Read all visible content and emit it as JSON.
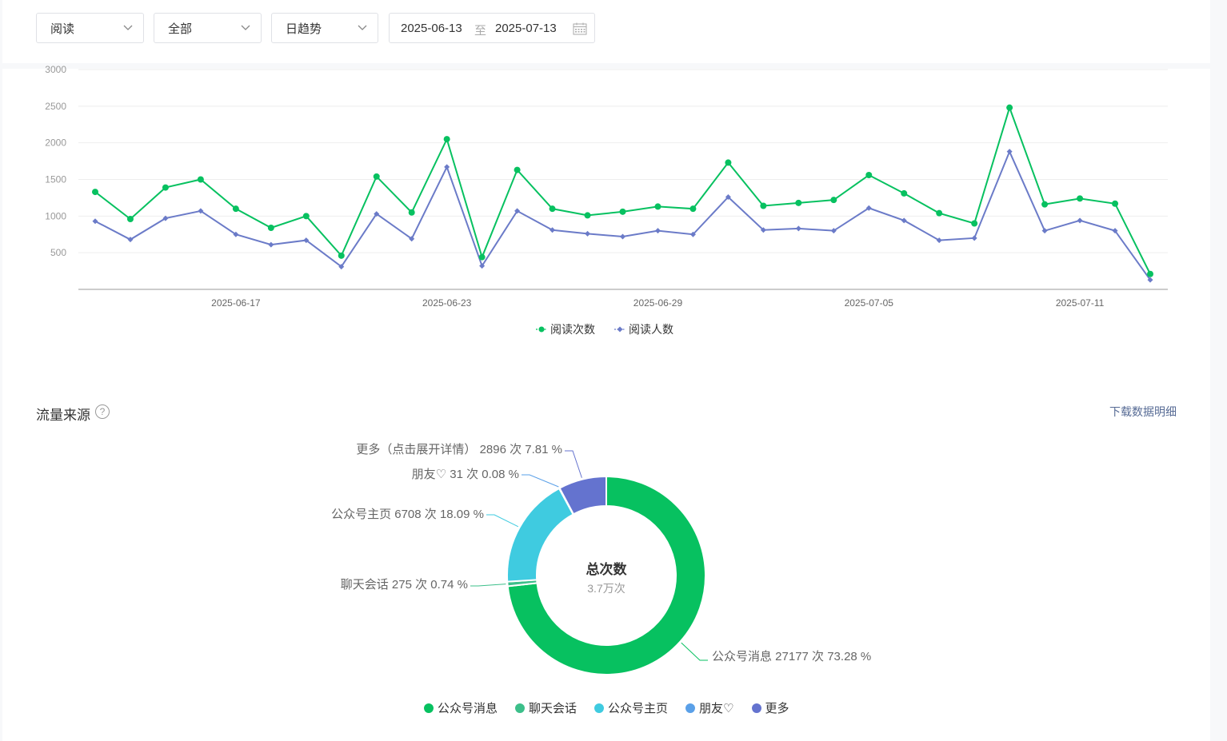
{
  "filters": {
    "metric": "阅读",
    "scope": "全部",
    "trend": "日趋势",
    "date_start": "2025-06-13",
    "date_sep": "至",
    "date_end": "2025-07-13"
  },
  "colors": {
    "green": "#07c160",
    "blue": "#6b7bc8",
    "teal": "#3cbf8a",
    "cyan": "#3fcbe0",
    "light_blue": "#5aa0e8",
    "indigo": "#6473cf"
  },
  "chart_data": [
    {
      "type": "line",
      "x": [
        "2025-06-13",
        "2025-06-14",
        "2025-06-15",
        "2025-06-16",
        "2025-06-17",
        "2025-06-18",
        "2025-06-19",
        "2025-06-20",
        "2025-06-21",
        "2025-06-22",
        "2025-06-23",
        "2025-06-24",
        "2025-06-25",
        "2025-06-26",
        "2025-06-27",
        "2025-06-28",
        "2025-06-29",
        "2025-06-30",
        "2025-07-01",
        "2025-07-02",
        "2025-07-03",
        "2025-07-04",
        "2025-07-05",
        "2025-07-06",
        "2025-07-07",
        "2025-07-08",
        "2025-07-09",
        "2025-07-10",
        "2025-07-11",
        "2025-07-12",
        "2025-07-13"
      ],
      "x_ticks": [
        "2025-06-17",
        "2025-06-23",
        "2025-06-29",
        "2025-07-05",
        "2025-07-11"
      ],
      "y_ticks": [
        "500",
        "1000",
        "1500",
        "2000",
        "2500",
        "3000"
      ],
      "ylim": [
        0,
        3000
      ],
      "grid": true,
      "legend_position": "bottom",
      "series": [
        {
          "name": "阅读次数",
          "marker": "circle",
          "color": "#07c160",
          "values": [
            1330,
            960,
            1390,
            1500,
            1100,
            840,
            1000,
            460,
            1540,
            1050,
            2050,
            440,
            1630,
            1100,
            1010,
            1060,
            1130,
            1100,
            1730,
            1140,
            1180,
            1220,
            1560,
            1310,
            1040,
            900,
            2480,
            1160,
            1240,
            1170,
            210
          ]
        },
        {
          "name": "阅读人数",
          "marker": "diamond",
          "color": "#6b7bc8",
          "values": [
            930,
            680,
            970,
            1070,
            750,
            610,
            670,
            310,
            1030,
            690,
            1670,
            320,
            1070,
            810,
            760,
            720,
            800,
            750,
            1260,
            810,
            830,
            800,
            1110,
            940,
            670,
            700,
            1880,
            800,
            940,
            800,
            130
          ]
        }
      ]
    },
    {
      "type": "pie",
      "donut": true,
      "center_title": "总次数",
      "center_value": "3.7万次",
      "slices": [
        {
          "name": "公众号消息",
          "value": 27177,
          "label": "公众号消息 27177 次 73.28 %",
          "color": "#07c160"
        },
        {
          "name": "聊天会话",
          "value": 275,
          "label": "聊天会话 275 次 0.74 %",
          "color": "#3cbf8a"
        },
        {
          "name": "公众号主页",
          "value": 6708,
          "label": "公众号主页 6708 次 18.09 %",
          "color": "#3fcbe0"
        },
        {
          "name": "朋友♡",
          "value": 31,
          "label": "朋友♡ 31 次 0.08 %",
          "color": "#5aa0e8"
        },
        {
          "name": "更多",
          "value": 2896,
          "label": "更多（点击展开详情） 2896 次 7.81 %",
          "color": "#6473cf"
        }
      ]
    }
  ],
  "traffic": {
    "title": "流量来源",
    "help": "?",
    "download": "下载数据明细"
  }
}
